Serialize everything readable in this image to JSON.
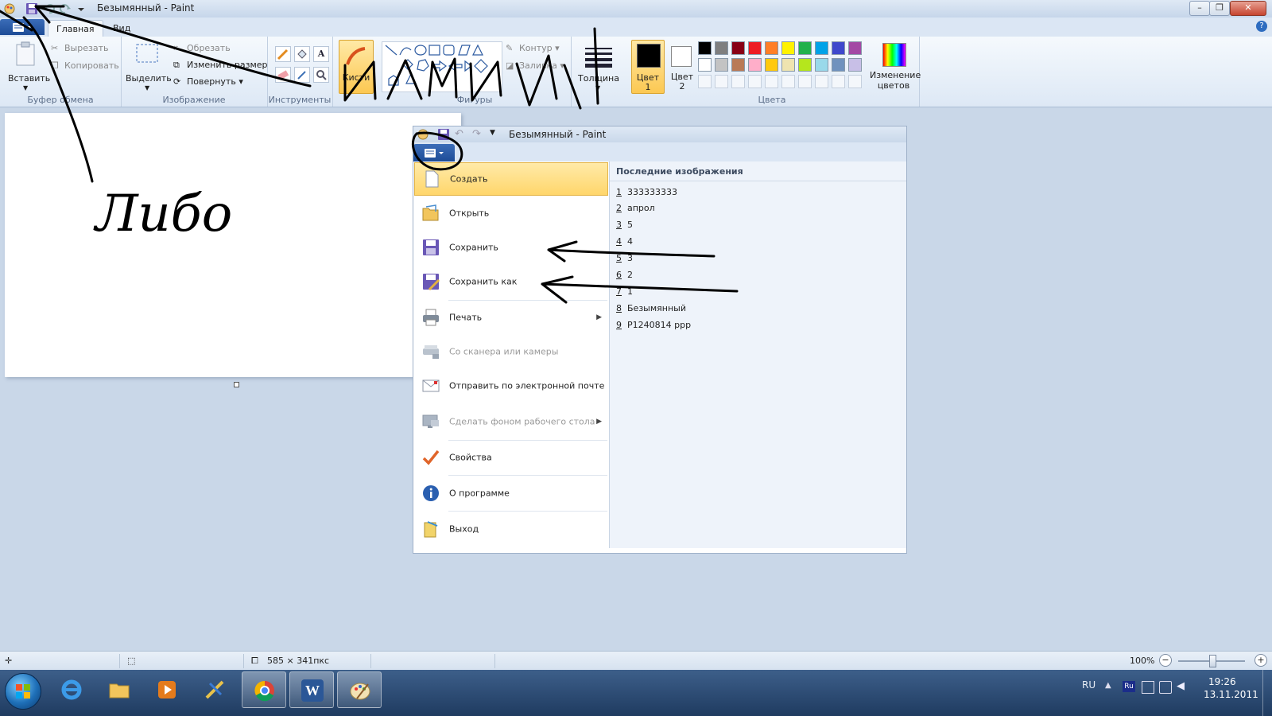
{
  "window": {
    "title": "Безымянный - Paint",
    "minimize": "–",
    "maximize": "❐",
    "close": "✕",
    "help": "?"
  },
  "tabs": {
    "home": "Главная",
    "view": "Вид"
  },
  "ribbon": {
    "clipboard": {
      "paste": "Вставить",
      "cut": "Вырезать",
      "copy": "Копировать",
      "label": "Буфер обмена"
    },
    "image": {
      "select": "Выделить",
      "crop": "Обрезать",
      "resize": "Изменить размер",
      "rotate": "Повернуть",
      "label": "Изображение"
    },
    "tools": {
      "label": "Инструменты",
      "text_tool": "A"
    },
    "brushes": {
      "label": "Кисти"
    },
    "shapes": {
      "outline": "Контур",
      "fill": "Заливка",
      "label": "Фигуры"
    },
    "size": {
      "label": "Толщина"
    },
    "colors": {
      "color1": "Цвет",
      "color1_num": "1",
      "color2": "Цвет",
      "color2_num": "2",
      "edit": "Изменение цветов",
      "label": "Цвета",
      "palette_row1": [
        "#000000",
        "#7f7f7f",
        "#880015",
        "#ed1c24",
        "#ff7f27",
        "#fff200",
        "#22b14c",
        "#00a2e8",
        "#3f48cc",
        "#a349a4"
      ],
      "palette_row2": [
        "#ffffff",
        "#c3c3c3",
        "#b97a57",
        "#ffaec9",
        "#ffc90e",
        "#efe4b0",
        "#b5e61d",
        "#99d9ea",
        "#7092be",
        "#c8bfe7"
      ]
    }
  },
  "menu": {
    "title": "Безымянный - Paint",
    "items": [
      {
        "label": "Создать"
      },
      {
        "label": "Открыть"
      },
      {
        "label": "Сохранить"
      },
      {
        "label": "Сохранить как"
      },
      {
        "label": "Печать"
      },
      {
        "label": "Со сканера или камеры"
      },
      {
        "label": "Отправить по электронной почте"
      },
      {
        "label": "Сделать фоном рабочего стола"
      },
      {
        "label": "Свойства"
      },
      {
        "label": "О программе"
      },
      {
        "label": "Выход"
      }
    ],
    "recent_header": "Последние изображения",
    "recent": [
      {
        "num": "1",
        "name": "333333333"
      },
      {
        "num": "2",
        "name": "апрол"
      },
      {
        "num": "3",
        "name": "5"
      },
      {
        "num": "4",
        "name": "4"
      },
      {
        "num": "5",
        "name": "3"
      },
      {
        "num": "6",
        "name": "2"
      },
      {
        "num": "7",
        "name": "1"
      },
      {
        "num": "8",
        "name": "Безымянный"
      },
      {
        "num": "9",
        "name": "P1240814 ppp"
      }
    ]
  },
  "status": {
    "dimensions": "585 × 341пкс",
    "zoom": "100%",
    "zoom_out": "−",
    "zoom_in": "+"
  },
  "taskbar": {
    "language": "RU",
    "time": "19:26",
    "date": "13.11.2011",
    "word_letter": "W",
    "kb_layout": "Ru"
  },
  "annotations": {
    "handwritten_word_1": "Либо",
    "handwritten_word_2": "ИЛИ"
  }
}
